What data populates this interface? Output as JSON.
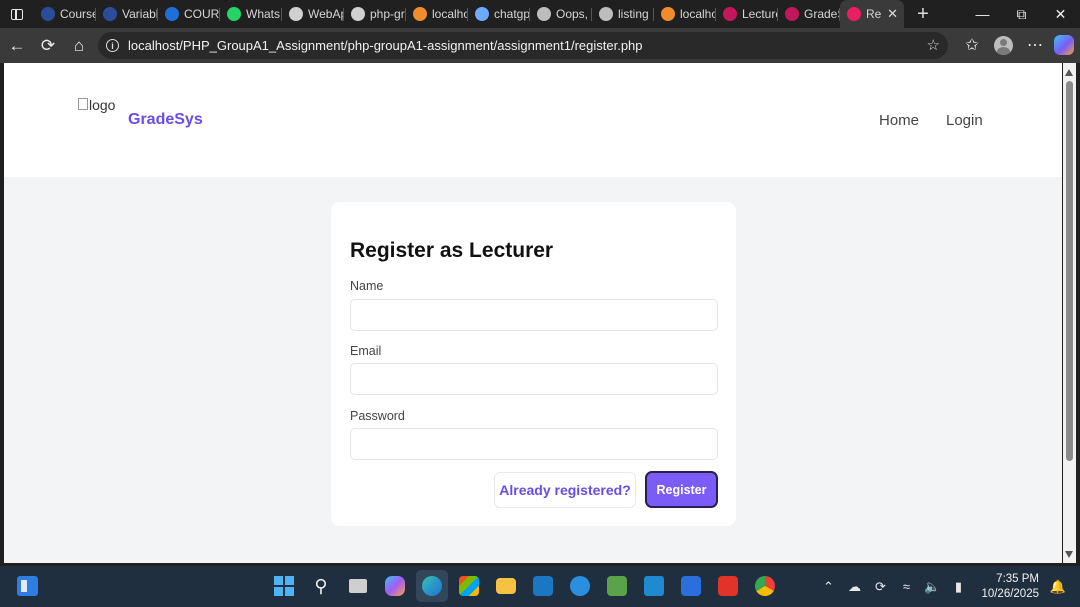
{
  "browser": {
    "tabs": [
      {
        "label": "Course",
        "icon": "c-icon",
        "color": "#2a4d9b"
      },
      {
        "label": "Variabl",
        "icon": "c-icon",
        "color": "#2a4d9b"
      },
      {
        "label": "COURS",
        "icon": "cloud-icon",
        "color": "#1e6fd9"
      },
      {
        "label": "Whats",
        "icon": "whatsapp-icon",
        "color": "#25d366"
      },
      {
        "label": "WebAp",
        "icon": "github-icon",
        "color": "#d0d0d0"
      },
      {
        "label": "php-gr",
        "icon": "github-icon",
        "color": "#d0d0d0"
      },
      {
        "label": "localho",
        "icon": "xampp-icon",
        "color": "#f08d2a"
      },
      {
        "label": "chatgp",
        "icon": "search-icon",
        "color": "#6ea8ff"
      },
      {
        "label": "Oops,",
        "icon": "openai-icon",
        "color": "#bdbdbd"
      },
      {
        "label": "listing",
        "icon": "globe-icon",
        "color": "#bdbdbd"
      },
      {
        "label": "localho",
        "icon": "xampp-icon",
        "color": "#f08d2a"
      },
      {
        "label": "Lecture",
        "icon": "app-icon",
        "color": "#c2185b"
      },
      {
        "label": "GradeS",
        "icon": "app-icon",
        "color": "#c2185b"
      },
      {
        "label": "Re",
        "icon": "app-icon",
        "color": "#e91e63",
        "active": true
      }
    ],
    "url": "localhost/PHP_GroupA1_Assignment/php-groupA1-assignment/assignment1/register.php"
  },
  "site": {
    "logo_alt": "logo",
    "brand": "GradeSys",
    "nav": [
      {
        "label": "Home"
      },
      {
        "label": "Login"
      }
    ]
  },
  "form": {
    "title": "Register as Lecturer",
    "name_label": "Name",
    "name_value": "",
    "email_label": "Email",
    "email_value": "",
    "password_label": "Password",
    "password_value": "",
    "login_link": "Already registered?",
    "submit_label": "Register"
  },
  "taskbar": {
    "time": "7:35 PM",
    "date": "10/26/2025"
  },
  "colors": {
    "accent": "#6a4ce6",
    "button": "#7c5cf6"
  }
}
